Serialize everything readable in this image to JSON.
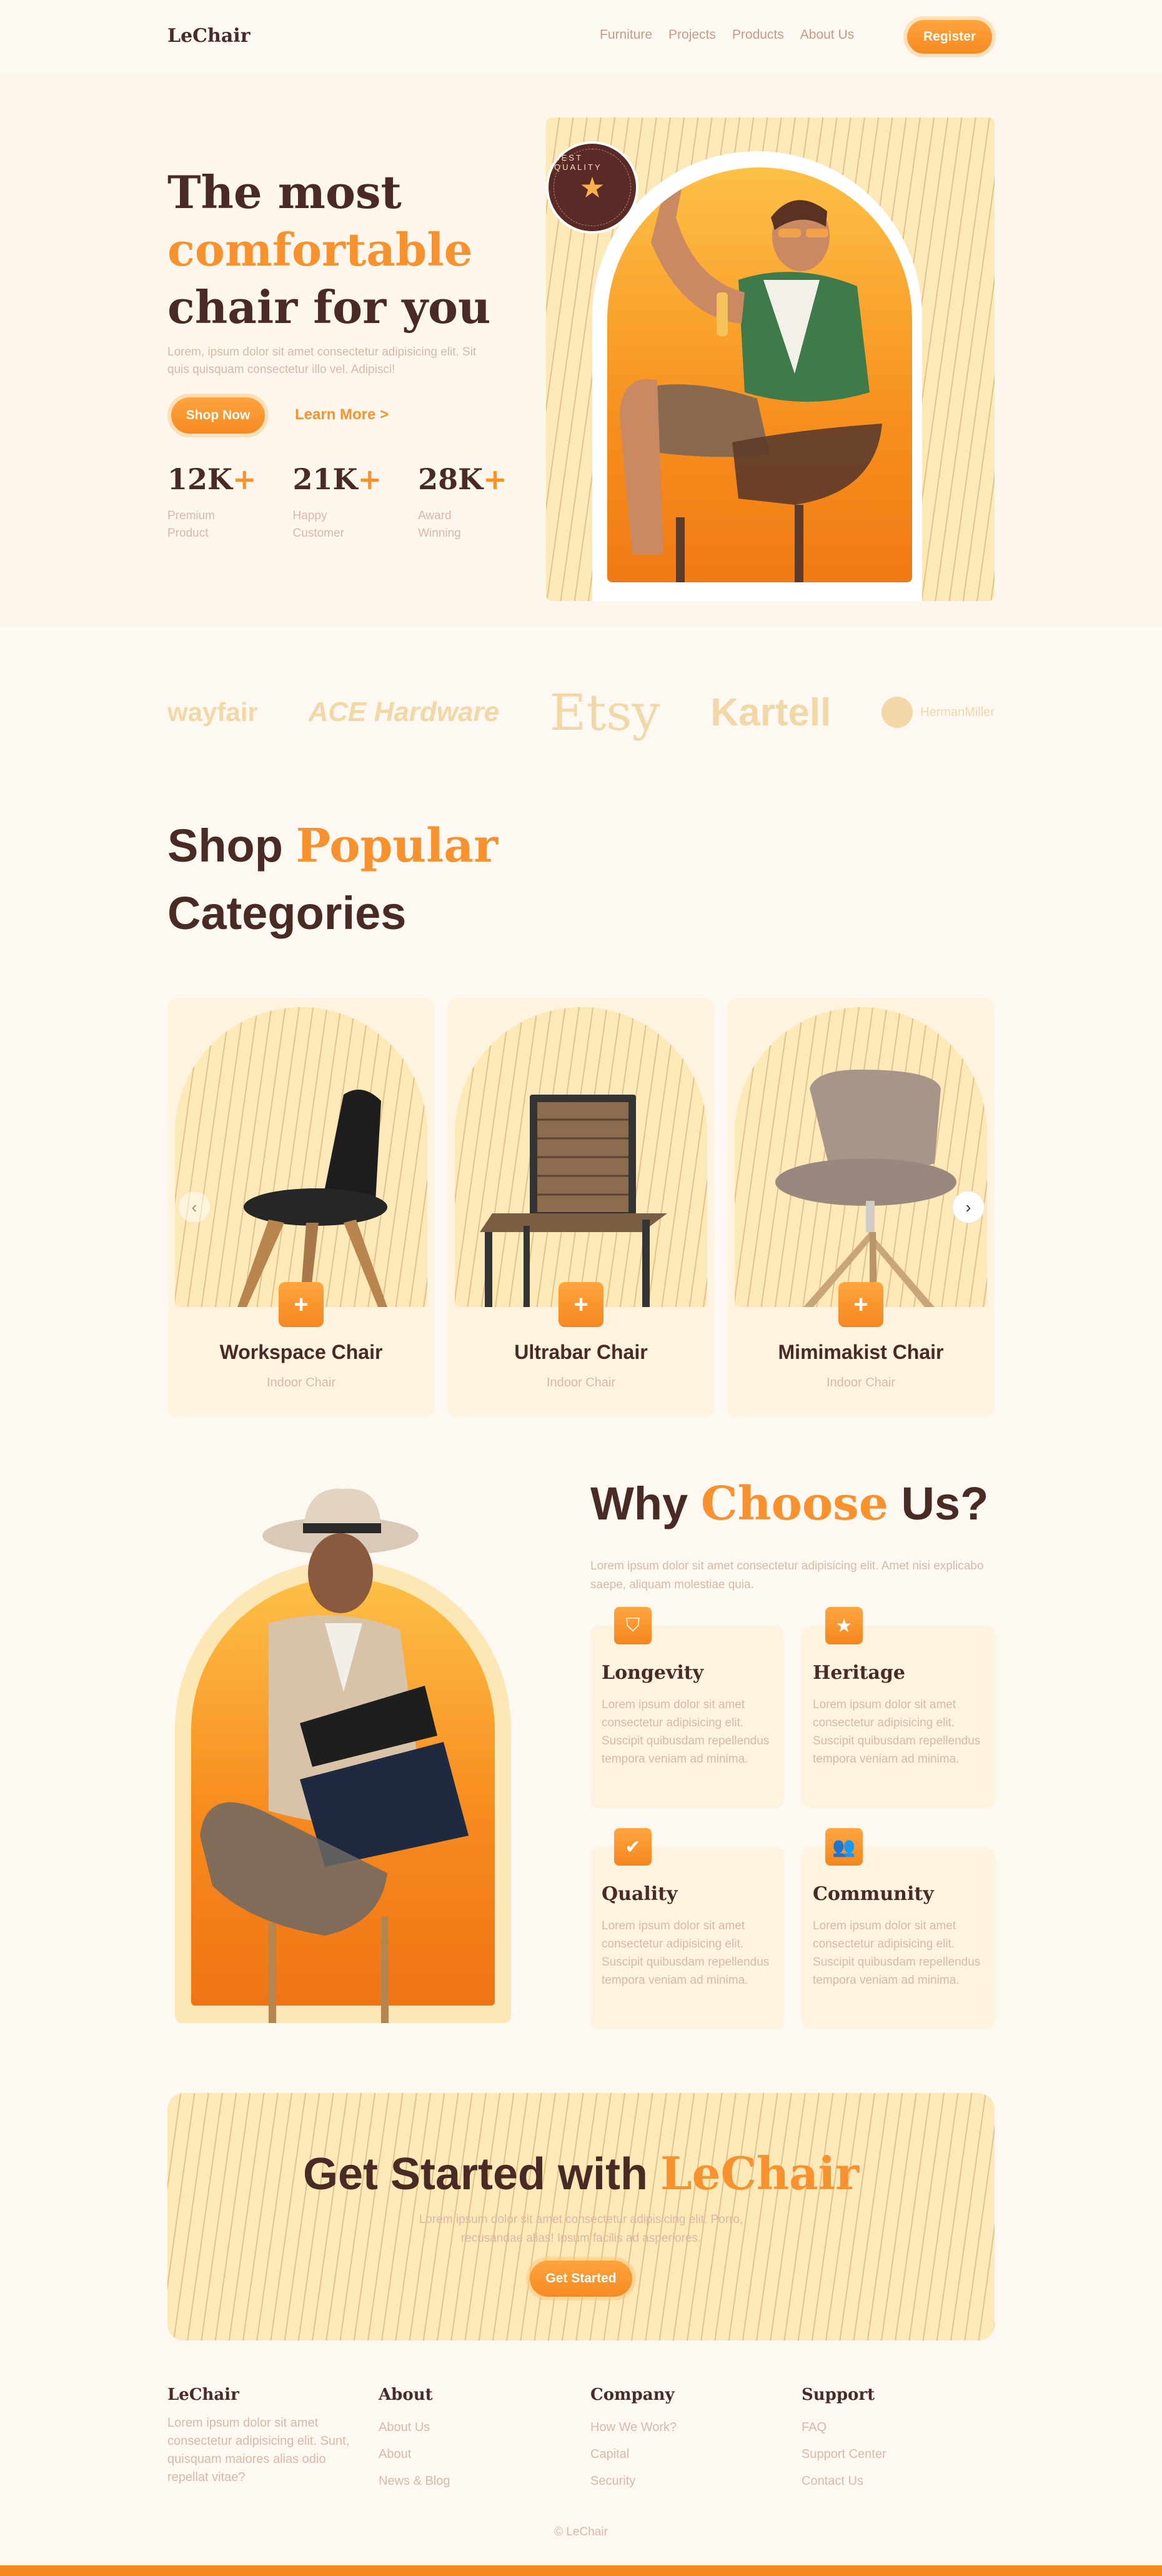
{
  "header": {
    "logo": "LeChair",
    "nav": [
      "Furniture",
      "Projects",
      "Products",
      "About Us"
    ],
    "register": "Register"
  },
  "hero": {
    "title_line1": "The most",
    "title_line2": "comfortable",
    "title_line3": "chair for you",
    "description": "Lorem, ipsum dolor sit amet consectetur adipisicing elit. Sit quis quisquam consectetur illo vel. Adipisci!",
    "shop_now": "Shop Now",
    "learn_more": "Learn More >",
    "stats": [
      {
        "value": "12K",
        "plus": "+",
        "label_1": "Premium",
        "label_2": "Product"
      },
      {
        "value": "21K",
        "plus": "+",
        "label_1": "Happy",
        "label_2": "Customer"
      },
      {
        "value": "28K",
        "plus": "+",
        "label_1": "Award",
        "label_2": "Winning"
      }
    ],
    "badge_text": "BEST QUALITY",
    "badge_icon": "star-icon"
  },
  "brands": [
    "wayfair",
    "ACE Hardware",
    "Etsy",
    "Kartell",
    "HermanMiller"
  ],
  "categories": {
    "title_part1": "Shop",
    "title_part2": "Popular",
    "title_part3": "Categories",
    "items": [
      {
        "name": "Workspace Chair",
        "sub": "Indoor Chair"
      },
      {
        "name": "Ultrabar Chair",
        "sub": "Indoor Chair"
      },
      {
        "name": "Mimimakist Chair",
        "sub": "Indoor Chair"
      }
    ],
    "prev_icon": "chevron-left-icon",
    "next_icon": "chevron-right-icon"
  },
  "why": {
    "title_part1": "Why",
    "title_part2": "Choose",
    "title_part3": "Us?",
    "description": "Lorem ipsum dolor sit amet consectetur adipisicing elit. Amet nisi explicabo saepe, aliquam molestiae quia.",
    "features": [
      {
        "title": "Longevity",
        "icon": "shield-icon",
        "text": "Lorem ipsum dolor sit amet consectetur adipisicing elit. Suscipit quibusdam repellendus tempora veniam ad minima."
      },
      {
        "title": "Heritage",
        "icon": "star-icon",
        "text": "Lorem ipsum dolor sit amet consectetur adipisicing elit. Suscipit quibusdam repellendus tempora veniam ad minima."
      },
      {
        "title": "Quality",
        "icon": "check-icon",
        "text": "Lorem ipsum dolor sit amet consectetur adipisicing elit. Suscipit quibusdam repellendus tempora veniam ad minima."
      },
      {
        "title": "Community",
        "icon": "users-icon",
        "text": "Lorem ipsum dolor sit amet consectetur adipisicing elit. Suscipit quibusdam repellendus tempora veniam ad minima."
      }
    ]
  },
  "cta": {
    "title_part1": "Get Started with",
    "title_part2": "LeChair",
    "description": "Lorem ipsum dolor sit amet consectetur adipisicing elit. Porro, recusandae alias! Ipsum facilis ad asperiores.",
    "button": "Get Started"
  },
  "footer": {
    "brand": "LeChair",
    "brand_desc": "Lorem ipsum dolor sit amet consectetur adipisicing elit. Sunt, quisquam maiores alias odio repellat vitae?",
    "about": {
      "heading": "About",
      "links": [
        "About Us",
        "About",
        "News & Blog"
      ]
    },
    "company": {
      "heading": "Company",
      "links": [
        "How We Work?",
        "Capital",
        "Security"
      ]
    },
    "support": {
      "heading": "Support",
      "links": [
        "FAQ",
        "Support Center",
        "Contact Us"
      ]
    },
    "copyright": "© LeChair"
  },
  "colors": {
    "accent": "#f7922e",
    "dark": "#4a2a24",
    "cream": "#fdf9f2",
    "sand": "#fde8b8"
  }
}
